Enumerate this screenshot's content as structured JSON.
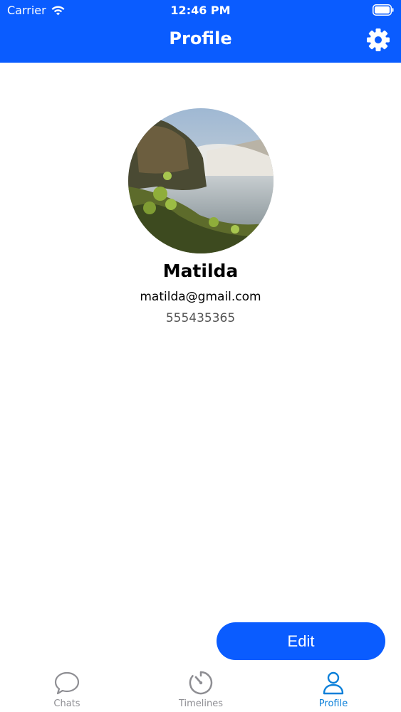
{
  "status_bar": {
    "carrier": "Carrier",
    "time": "12:46 PM"
  },
  "nav": {
    "title": "Profile",
    "settings_icon": "gear-icon"
  },
  "profile": {
    "name": "Matilda",
    "email": "matilda@gmail.com",
    "phone": "555435365",
    "avatar": "waterfall-landscape-photo"
  },
  "actions": {
    "edit_label": "Edit"
  },
  "tabs": [
    {
      "label": "Chats",
      "icon": "speech-bubble-icon",
      "active": false
    },
    {
      "label": "Timelines",
      "icon": "timer-icon",
      "active": false
    },
    {
      "label": "Profile",
      "icon": "person-icon",
      "active": true
    }
  ],
  "colors": {
    "accent": "#0a5cff",
    "tab_active": "#0a7fd9",
    "tab_inactive": "#8e8e93"
  }
}
